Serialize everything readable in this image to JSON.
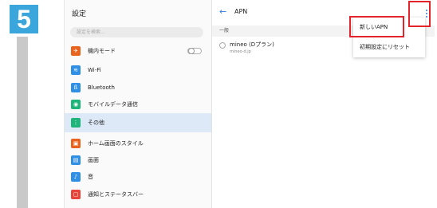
{
  "step": {
    "number": "5"
  },
  "sidebar": {
    "title": "設定",
    "search_placeholder": "設定を検索...",
    "items": [
      {
        "label": "機内モード",
        "icon": "airplane-icon",
        "color": "#e8641e"
      },
      {
        "label": "Wi-Fi",
        "icon": "wifi-icon",
        "color": "#2f8fe5"
      },
      {
        "label": "Bluetooth",
        "icon": "bluetooth-icon",
        "color": "#2f8fe5"
      },
      {
        "label": "モバイルデータ通信",
        "icon": "mobile-data-icon",
        "color": "#1fb47a"
      },
      {
        "label": "その他",
        "icon": "more-icon",
        "color": "#1fb47a"
      },
      {
        "label": "ホーム画面のスタイル",
        "icon": "home-style-icon",
        "color": "#e8641e"
      },
      {
        "label": "画面",
        "icon": "display-icon",
        "color": "#2f8fe5"
      },
      {
        "label": "音",
        "icon": "sound-icon",
        "color": "#2f8fe5"
      },
      {
        "label": "通知とステータスバー",
        "icon": "notification-icon",
        "color": "#e8443a"
      }
    ]
  },
  "main": {
    "title": "APN",
    "section": "一般",
    "apn": {
      "name": "mineo (Dプラン)",
      "sub": "mineo-d.jp"
    }
  },
  "menu": {
    "items": [
      "新しいAPN",
      "初期設定にリセット"
    ]
  },
  "colors": {
    "accent": "#3a7bd5",
    "highlight": "#e5232a",
    "step_badge": "#3aa6db"
  }
}
